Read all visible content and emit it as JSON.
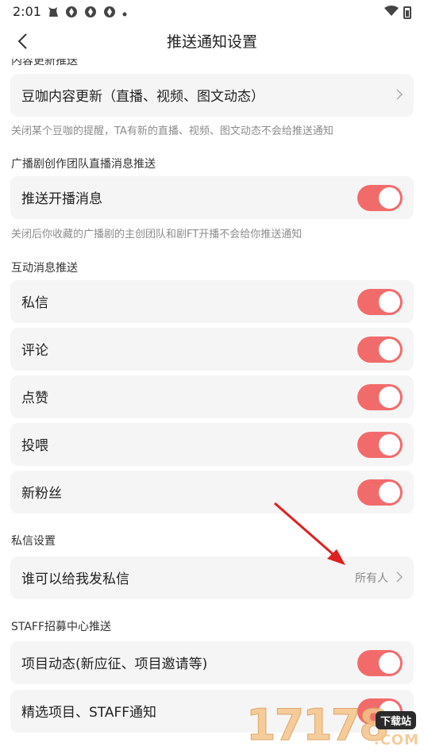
{
  "status_bar": {
    "time": "2:01",
    "left_icons": [
      "cat-notification-icon",
      "app-notification-icon",
      "app-notification-icon",
      "app-notification-icon",
      "more-dot-icon"
    ],
    "right_icons": [
      "wifi-icon",
      "battery-icon"
    ]
  },
  "nav": {
    "title": "推送通知设置"
  },
  "sections": {
    "content_update": {
      "title_partial": "内容更新推送",
      "item_label": "豆咖内容更新（直播、视频、图文动态）",
      "hint": "关闭某个豆咖的提醒，TA有新的直播、视频、图文动态不会给推送通知"
    },
    "radio_team": {
      "title": "广播剧创作团队直播消息推送",
      "item_label": "推送开播消息",
      "item_on": true,
      "hint": "关闭后你收藏的广播剧的主创团队和剧FT开播不会给你推送通知"
    },
    "interaction": {
      "title": "互动消息推送",
      "items": [
        {
          "label": "私信",
          "on": true
        },
        {
          "label": "评论",
          "on": true
        },
        {
          "label": "点赞",
          "on": true
        },
        {
          "label": "投喂",
          "on": true
        },
        {
          "label": "新粉丝",
          "on": true
        }
      ]
    },
    "dm_settings": {
      "title": "私信设置",
      "item_label": "谁可以给我发私信",
      "item_value": "所有人"
    },
    "staff": {
      "title": "STAFF招募中心推送",
      "items": [
        {
          "label": "项目动态(新应征、项目邀请等)",
          "on": true
        },
        {
          "label": "精选项目、STAFF通知",
          "on": true
        }
      ]
    }
  },
  "colors": {
    "toggle_on": "#f26b6b",
    "card_bg": "#f5f5f5",
    "annotation_arrow": "#e02020"
  },
  "watermark": {
    "text": "17178",
    "badge": "下载站",
    "sub": ".COM"
  }
}
